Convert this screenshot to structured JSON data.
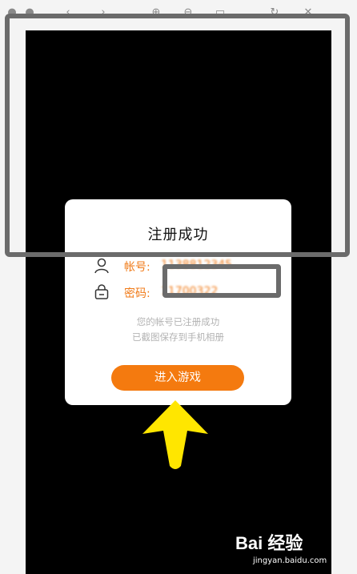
{
  "dialog": {
    "title": "注册成功",
    "account_label": "帐号:",
    "account_value": "1138812345",
    "password_label": "密码:",
    "password_value": "11700322",
    "note_line1": "您的帐号已注册成功",
    "note_line2": "已截图保存到手机相册",
    "enter_button": "进入游戏"
  },
  "watermark": {
    "brand": "Bai 经验",
    "url": "jingyan.baidu.com"
  },
  "colors": {
    "accent": "#f47a0f",
    "label_orange": "#f07a17",
    "note_gray": "#b3b3b3",
    "annotation_gray": "#6b6b6b",
    "arrow_yellow": "#ffe600"
  },
  "icons": [
    "user-icon",
    "lock-icon",
    "arrow-icon"
  ]
}
